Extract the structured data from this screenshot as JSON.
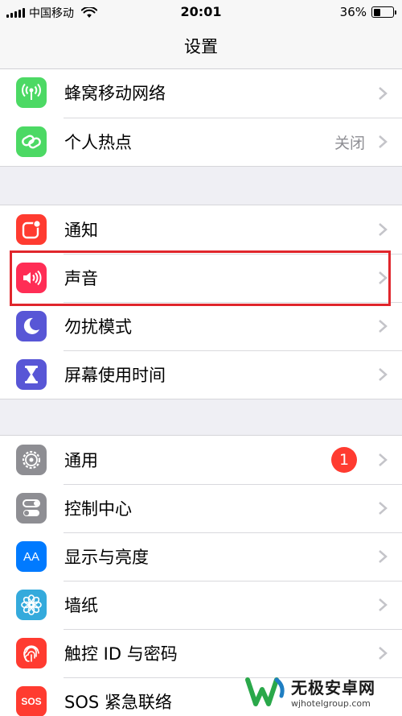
{
  "status_bar": {
    "carrier": "中国移动",
    "time": "20:01",
    "battery_text": "36%",
    "battery_level": 0.36
  },
  "nav": {
    "title": "设置"
  },
  "groups": [
    {
      "rows": [
        {
          "label": "蜂窝移动网络",
          "icon": "antenna-icon",
          "color": "#4cd964"
        },
        {
          "label": "个人热点",
          "value": "关闭",
          "icon": "hotspot-chain-icon",
          "color": "#4cd964"
        }
      ]
    },
    {
      "rows": [
        {
          "label": "通知",
          "icon": "notifications-icon",
          "color": "#ff3b30"
        },
        {
          "label": "声音",
          "icon": "speaker-icon",
          "color": "#ff2d55",
          "highlighted": true
        },
        {
          "label": "勿扰模式",
          "icon": "moon-icon",
          "color": "#5856d6"
        },
        {
          "label": "屏幕使用时间",
          "icon": "hourglass-icon",
          "color": "#5856d6"
        }
      ]
    },
    {
      "rows": [
        {
          "label": "通用",
          "badge": "1",
          "icon": "gear-icon",
          "color": "#8e8e93"
        },
        {
          "label": "控制中心",
          "icon": "toggles-icon",
          "color": "#8e8e93"
        },
        {
          "label": "显示与亮度",
          "icon": "text-size-icon",
          "color": "#007aff",
          "glyph": "AA"
        },
        {
          "label": "墙纸",
          "icon": "flower-icon",
          "color": "#34aadc"
        },
        {
          "label": "触控 ID 与密码",
          "icon": "fingerprint-icon",
          "color": "#ff3b30"
        },
        {
          "label": "SOS 紧急联络",
          "icon": "sos-icon",
          "color": "#ff3b30",
          "glyph": "SOS"
        }
      ]
    }
  ],
  "watermark": {
    "brand": "无极安卓网",
    "url": "wjhotelgroup.com"
  }
}
